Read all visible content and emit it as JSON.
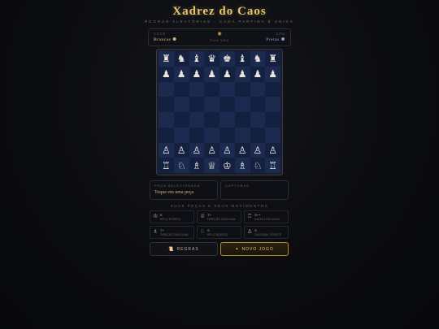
{
  "header": {
    "title": "Xadrez do Caos",
    "subtitle": "REGRAS ALEATÓRIAS · CADA PARTIDA É ÚNICA"
  },
  "turn": {
    "left_caption": "VOCÊ",
    "left_name": "Brancas",
    "left_glyph": "⚉",
    "center_glyph": "◉",
    "center_status": "SUA VEZ",
    "right_caption": "CPU",
    "right_name": "Pretas",
    "right_glyph": "⚉"
  },
  "board": {
    "light_color": "#1d2a4f",
    "dark_color": "#142040",
    "rows": [
      [
        "♜",
        "♞",
        "♝",
        "♛",
        "♚",
        "♝",
        "♞",
        "♜"
      ],
      [
        "♟",
        "♟",
        "♟",
        "♟",
        "♟",
        "♟",
        "♟",
        "♟"
      ],
      [
        "",
        "",
        "",
        "",
        "",
        "",
        "",
        ""
      ],
      [
        "",
        "",
        "",
        "",
        "",
        "",
        "",
        ""
      ],
      [
        "",
        "",
        "",
        "",
        "",
        "",
        "",
        ""
      ],
      [
        "",
        "",
        "",
        "",
        "",
        "",
        "",
        ""
      ],
      [
        "♙",
        "♙",
        "♙",
        "♙",
        "♙",
        "♙",
        "♙",
        "♙"
      ],
      [
        "♖",
        "♘",
        "♗",
        "♕",
        "♔",
        "♗",
        "♘",
        "♖"
      ]
    ]
  },
  "selected": {
    "caption": "PEÇA SELECIONADA",
    "value": "Toque em uma peça"
  },
  "captured": {
    "caption": "CAPTURAS",
    "value": ""
  },
  "moves": {
    "title": "SUAS PEÇAS E SEUS MOVIMENTOS",
    "items": [
      {
        "icon": "♔",
        "count": "K",
        "desc": "REI (1 BORDO)"
      },
      {
        "icon": "♕",
        "count": "T+",
        "desc": "DIREÇÃO DIAGONAL"
      },
      {
        "icon": "♖",
        "count": "S++",
        "desc": "SALTA 2 EM LINHA"
      },
      {
        "icon": "♗",
        "count": "T+",
        "desc": "DIREÇÃO DIAGONAL"
      },
      {
        "icon": "♘",
        "count": "S",
        "desc": "REI (1 BORDO)"
      },
      {
        "icon": "♙",
        "count": "S",
        "desc": "DIAGONAL FRENTE"
      }
    ]
  },
  "buttons": {
    "rules_icon": "📜",
    "rules_label": "REGRAS",
    "new_icon": "✦",
    "new_label": "NOVO JOGO"
  }
}
